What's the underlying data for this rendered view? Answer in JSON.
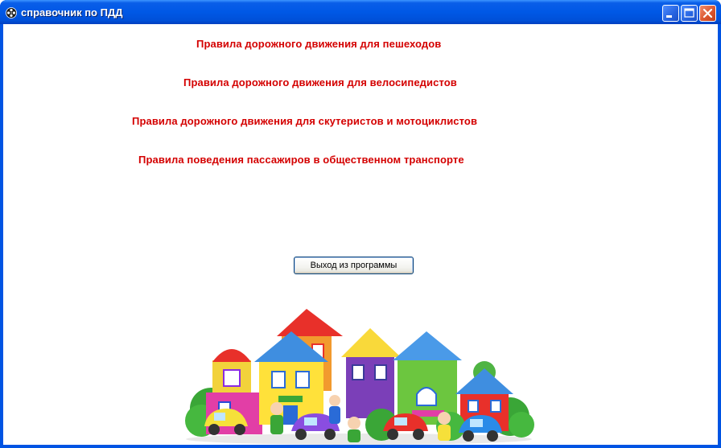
{
  "window": {
    "title": "справочник по ПДД",
    "minimize_label": "",
    "maximize_label": "",
    "close_label": ""
  },
  "links": [
    "Правила дорожного движения для пешеходов",
    "Правила дорожного движения для велосипедистов",
    "Правила дорожного движения для скутеристов и мотоциклистов",
    "Правила поведения  пассажиров в общественном транспорте"
  ],
  "exit_button": "Выход из программы",
  "colors": {
    "title_bar": "#0058e6",
    "link_text": "#d40000",
    "close_button": "#d9532c"
  },
  "icons": {
    "title": "film-reel-icon",
    "minimize": "minimize-icon",
    "maximize": "maximize-icon",
    "close": "close-icon"
  }
}
